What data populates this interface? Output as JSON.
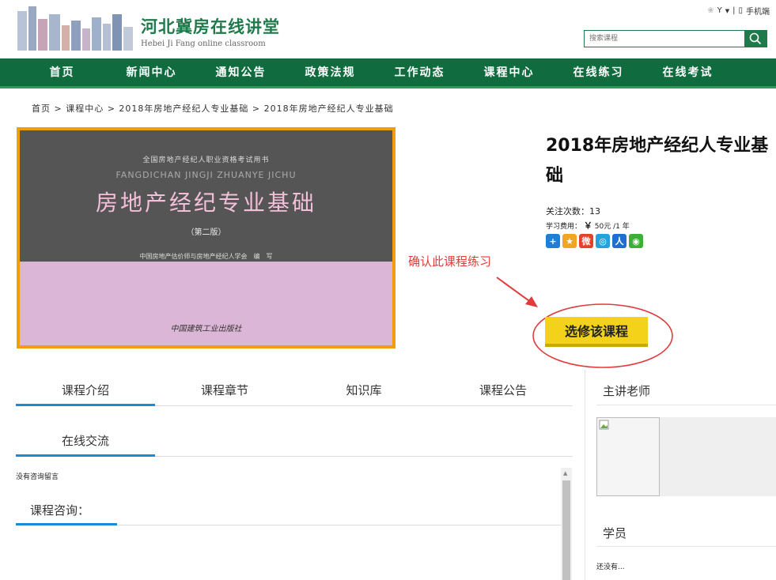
{
  "header": {
    "site_title": "河北冀房在线讲堂",
    "site_subtitle": "Hebei Ji Fang online classroom",
    "user_label": "Y",
    "mobile_label": "手机端",
    "search_placeholder": "搜索课程"
  },
  "nav": {
    "items": [
      "首页",
      "新闻中心",
      "通知公告",
      "政策法规",
      "工作动态",
      "课程中心",
      "在线练习",
      "在线考试"
    ]
  },
  "breadcrumb": "首页 > 课程中心 > 2018年房地产经纪人专业基础 > 2018年房地产经纪人专业基础",
  "cover": {
    "series": "全国房地产经纪人职业资格考试用书",
    "pinyin": "FANGDICHAN JINGJI ZHUANYE JICHU",
    "title": "房地产经纪专业基础",
    "edition": "（第二版）",
    "author": "中国房地产估价师与房地产经纪人学会　编　写",
    "publisher": "中国建筑工业出版社"
  },
  "course": {
    "title": "2018年房地产经纪人专业基础",
    "follow_label": "关注次数：13",
    "fee_label": "学习费用：",
    "fee_yen": "￥",
    "fee_value": "50元 /1 年",
    "enroll_label": "选修该课程"
  },
  "annotation": "确认此课程练习",
  "share_icons": [
    {
      "name": "plus-share-icon",
      "color": "#1e7fd6",
      "glyph": "+"
    },
    {
      "name": "qzone-icon",
      "color": "#f0a623",
      "glyph": "★"
    },
    {
      "name": "weibo-icon",
      "color": "#e8402c",
      "glyph": "微"
    },
    {
      "name": "tencent-weibo-icon",
      "color": "#25a2dc",
      "glyph": "◎"
    },
    {
      "name": "renren-icon",
      "color": "#1d6fd0",
      "glyph": "人"
    },
    {
      "name": "wechat-icon",
      "color": "#3ab037",
      "glyph": "◉"
    }
  ],
  "tabs": {
    "row1": [
      "课程介绍",
      "课程章节",
      "知识库",
      "课程公告"
    ],
    "row2": [
      "在线交流"
    ]
  },
  "consult": {
    "empty_text": "没有咨询留言",
    "label": "课程咨询："
  },
  "sidebar": {
    "teacher_title": "主讲老师",
    "student_title": "学员",
    "student_none": "还没有..."
  }
}
